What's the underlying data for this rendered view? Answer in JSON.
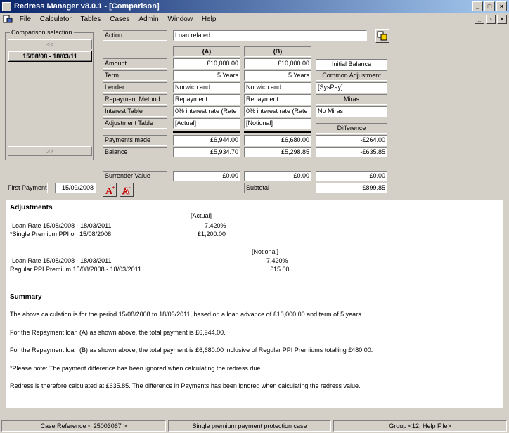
{
  "window": {
    "title": "Redress Manager v8.0.1 - [Comparison]"
  },
  "menu": [
    "File",
    "Calculator",
    "Tables",
    "Cases",
    "Admin",
    "Window",
    "Help"
  ],
  "sidebar": {
    "group_label": "Comparison selection",
    "prev_label": "<<",
    "next_label": ">>",
    "selected_range": "15/08/08 - 18/03/11"
  },
  "form": {
    "action_label": "Action",
    "action_value": "Loan related",
    "col_a": "(A)",
    "col_b": "(B)",
    "labels": {
      "amount": "Amount",
      "term": "Term",
      "lender": "Lender",
      "repayment_method": "Repayment Method",
      "interest_table": "Interest Table",
      "adjustment_table": "Adjustment Table",
      "payments_made": "Payments made",
      "balance": "Balance",
      "surrender_value": "Surrender Value",
      "first_payment": "First Payment",
      "subtotal": "Subtotal"
    },
    "a": {
      "amount": "£10,000.00",
      "term": "5 Years",
      "lender": "Norwich and",
      "repayment_method": "Repayment",
      "interest_table": "0% interest rate (Rate",
      "adjustment_table": "[Actual]",
      "payments_made": "£6,944.00",
      "balance": "£5,934.70",
      "surrender_value": "£0.00"
    },
    "b": {
      "amount": "£10,000.00",
      "term": "5 Years",
      "lender": "Norwich and",
      "repayment_method": "Repayment",
      "interest_table": "0% interest rate (Rate",
      "adjustment_table": "[Notional]",
      "payments_made": "£6,680.00",
      "balance": "£5,298.85",
      "surrender_value": "£0.00"
    },
    "right": {
      "initial_balance": "Initial Balance",
      "common_adjustment": "Common Adjustment",
      "syspay": "[SysPay]",
      "miras": "Miras",
      "no_miras": "No Miras",
      "difference": "Difference",
      "diff_payments": "-£264.00",
      "diff_balance": "-£635.85",
      "diff_surrender": "£0.00",
      "subtotal": "-£899.85"
    },
    "first_payment_value": "15/09/2008"
  },
  "report": {
    "adjustments_heading": "Adjustments",
    "actual_header": "[Actual]",
    "actual_rows": [
      {
        "label": "Loan Rate 15/08/2008 - 18/03/2011",
        "value": "7.420%"
      },
      {
        "label": "*Single Premium PPI on 15/08/2008",
        "value": "£1,200.00"
      }
    ],
    "notional_header": "[Notional]",
    "notional_rows": [
      {
        "label": "Loan Rate 15/08/2008 - 18/03/2011",
        "value": "7.420%"
      },
      {
        "label": "Regular PPI Premium 15/08/2008 - 18/03/2011",
        "value": "£15.00"
      }
    ],
    "summary_heading": "Summary",
    "paragraphs": [
      "The above calculation is for the period 15/08/2008 to 18/03/2011, based on a loan advance of £10,000.00 and term of 5 years.",
      "For the Repayment loan (A) as shown above, the total payment is £6,944.00.",
      "For the Repayment loan (B) as shown above, the total payment is £6,680.00 inclusive of Regular PPI Premiums totalling £480.00.",
      "*Please note: The payment difference has been ignored when calculating the redress due.",
      "Redress is therefore calculated at £635.85. The difference in Payments has been ignored when calculating the redress value."
    ]
  },
  "status": {
    "case_reference": "Case Reference < 25003067 >",
    "case_type": "Single premium payment protection case",
    "group": "Group <12. Help File>"
  },
  "icons": {
    "app": "app-icon",
    "doc": "document-icon",
    "compare": "compare-icon",
    "font_add": "font-bold-icon",
    "font_remove": "font-outline-icon"
  }
}
